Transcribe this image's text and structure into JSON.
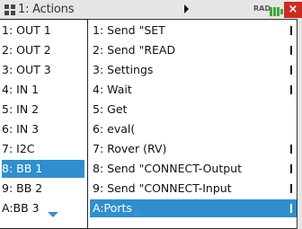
{
  "titlebar": {
    "title": "1: Actions",
    "mode": "RAD",
    "close_glyph": "×",
    "doc_icon": "document-icon",
    "battery_icon": "battery-icon"
  },
  "actions_menu": {
    "items": [
      {
        "label": "1: OUT 1",
        "selected": false
      },
      {
        "label": "2: OUT 2",
        "selected": false
      },
      {
        "label": "3: OUT 3",
        "selected": false
      },
      {
        "label": "4: IN 1",
        "selected": false
      },
      {
        "label": "5: IN 2",
        "selected": false
      },
      {
        "label": "6: IN 3",
        "selected": false
      },
      {
        "label": "7: I2C",
        "selected": false
      },
      {
        "label": "8: BB 1",
        "selected": true
      },
      {
        "label": "9: BB 2",
        "selected": false
      },
      {
        "label": "A:BB 3",
        "selected": false
      }
    ],
    "more_indicator": "chevron-down-icon"
  },
  "main_menu": {
    "items": [
      {
        "label": "1: Send \"SET",
        "submenu": true,
        "selected": false
      },
      {
        "label": "2: Send \"READ",
        "submenu": true,
        "selected": false
      },
      {
        "label": "3: Settings",
        "submenu": true,
        "selected": false
      },
      {
        "label": "4: Wait",
        "submenu": true,
        "selected": false
      },
      {
        "label": "5: Get",
        "submenu": false,
        "selected": false
      },
      {
        "label": "6: eval(",
        "submenu": false,
        "selected": false
      },
      {
        "label": "7: Rover (RV)",
        "submenu": true,
        "selected": false
      },
      {
        "label": "8: Send \"CONNECT-Output",
        "submenu": true,
        "selected": false
      },
      {
        "label": "9: Send \"CONNECT-Input",
        "submenu": true,
        "selected": false
      },
      {
        "label": "A:Ports",
        "submenu": true,
        "selected": true
      }
    ],
    "more_indicator": "chevron-down-icon"
  },
  "colors": {
    "highlight": "#2f8fce",
    "close": "#cc2b22"
  }
}
